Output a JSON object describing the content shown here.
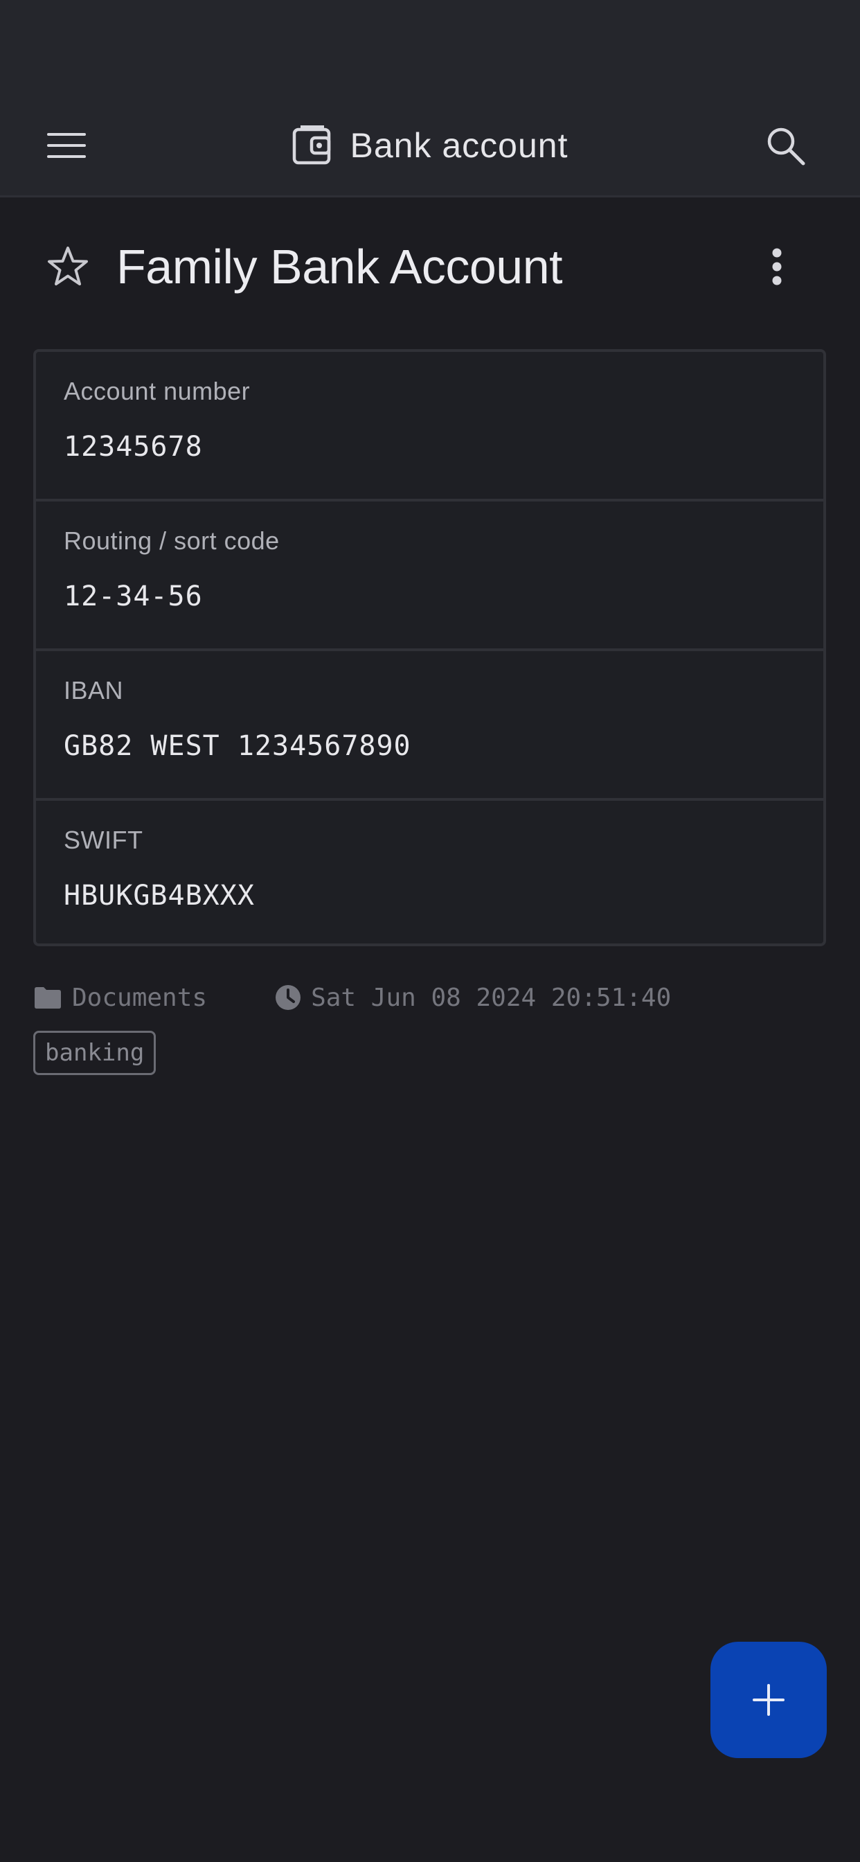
{
  "topbar": {
    "title": "Bank account",
    "icons": {
      "menu": "hamburger-menu-icon",
      "app": "wallet-icon",
      "search": "search-icon"
    }
  },
  "item": {
    "title": "Family Bank Account",
    "favorite": false,
    "fields": [
      {
        "label": "Account number",
        "value": "12345678"
      },
      {
        "label": "Routing / sort code",
        "value": "12-34-56"
      },
      {
        "label": "IBAN",
        "value": "GB82 WEST 1234567890"
      },
      {
        "label": "SWIFT",
        "value": "HBUKGB4BXXX"
      }
    ],
    "folder": "Documents",
    "modified": "Sat Jun 08 2024 20:51:40",
    "tags": [
      "banking"
    ]
  },
  "colors": {
    "background": "#1c1c21",
    "topbar": "#25262c",
    "fab": "#0a43b3"
  }
}
